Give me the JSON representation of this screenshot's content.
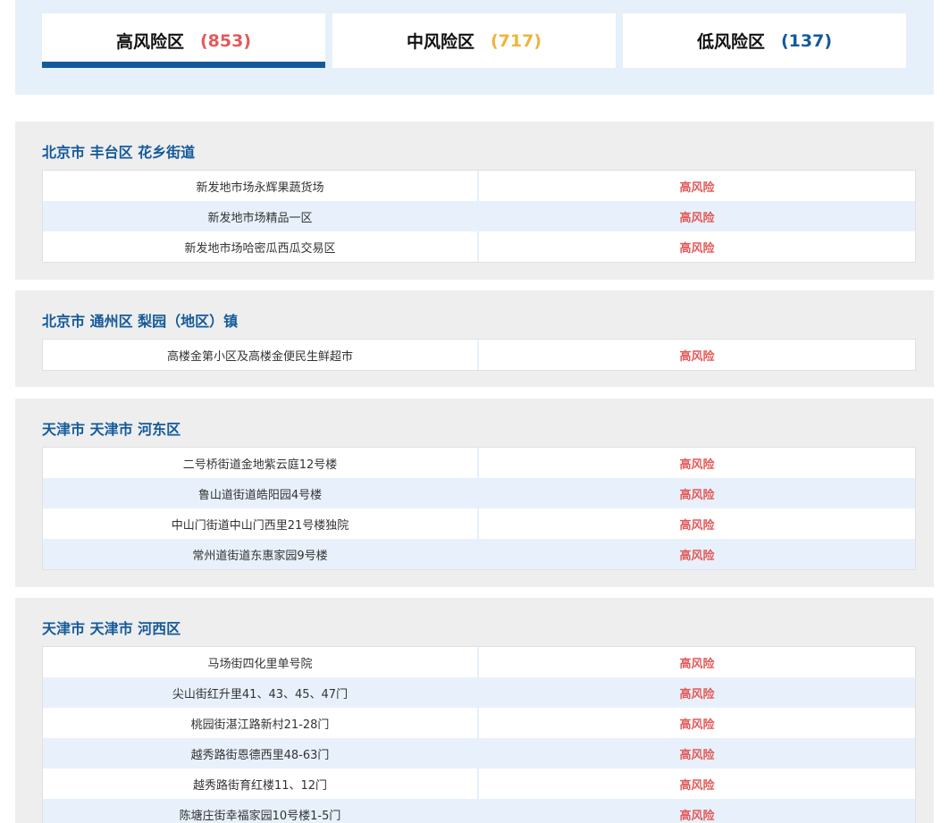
{
  "tabs": [
    {
      "label": "高风险区",
      "count": "(853)",
      "count_color": "#e25a5a",
      "active": true
    },
    {
      "label": "中风险区",
      "count": "(717)",
      "count_color": "#f0b43c",
      "active": false
    },
    {
      "label": "低风险区",
      "count": "(137)",
      "count_color": "#145a9a",
      "active": false
    }
  ],
  "sections": [
    {
      "title": "北京市 丰台区 花乡街道",
      "rows": [
        {
          "location": "新发地市场永辉果蔬货场",
          "risk": "高风险"
        },
        {
          "location": "新发地市场精品一区",
          "risk": "高风险"
        },
        {
          "location": "新发地市场哈密瓜西瓜交易区",
          "risk": "高风险"
        }
      ]
    },
    {
      "title": "北京市 通州区 梨园（地区）镇",
      "rows": [
        {
          "location": "高楼金第小区及高楼金便民生鲜超市",
          "risk": "高风险"
        }
      ]
    },
    {
      "title": "天津市 天津市 河东区",
      "rows": [
        {
          "location": "二号桥街道金地紫云庭12号楼",
          "risk": "高风险"
        },
        {
          "location": "鲁山道街道皓阳园4号楼",
          "risk": "高风险"
        },
        {
          "location": "中山门街道中山门西里21号楼独院",
          "risk": "高风险"
        },
        {
          "location": "常州道街道东惠家园9号楼",
          "risk": "高风险"
        }
      ]
    },
    {
      "title": "天津市 天津市 河西区",
      "rows": [
        {
          "location": "马场街四化里单号院",
          "risk": "高风险"
        },
        {
          "location": "尖山街红升里41、43、45、47门",
          "risk": "高风险"
        },
        {
          "location": "桃园街湛江路新村21-28门",
          "risk": "高风险"
        },
        {
          "location": "越秀路街恩德西里48-63门",
          "risk": "高风险"
        },
        {
          "location": "越秀路街育红楼11、12门",
          "risk": "高风险"
        },
        {
          "location": "陈塘庄街幸福家园10号楼1-5门",
          "risk": "高风险"
        }
      ]
    }
  ],
  "colors": {
    "accent": "#145a9a",
    "high": "#e25a5a",
    "mid": "#f0b43c"
  }
}
